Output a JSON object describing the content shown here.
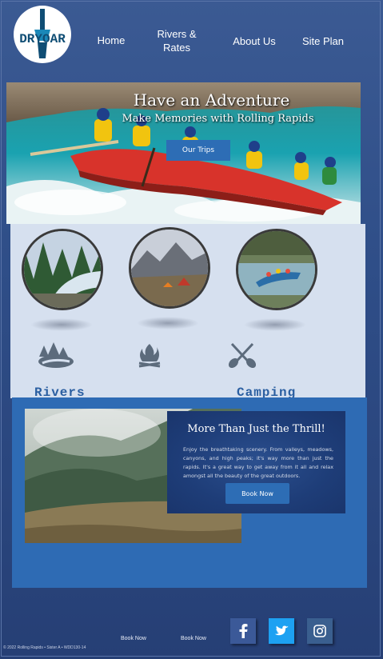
{
  "logo": {
    "text": "DRYOAR"
  },
  "nav": {
    "home": "Home",
    "rivers_rates_1": "Rivers &",
    "rivers_rates_2": "Rates",
    "about": "About Us",
    "site_plan": "Site Plan"
  },
  "hero": {
    "title": "Have an Adventure",
    "subtitle": "Make Memories with Rolling Rapids",
    "cta": "Our Trips"
  },
  "features": {
    "labels": [
      "Rivers",
      "Camping"
    ],
    "icons": [
      "forest-river-icon",
      "campfire-icon",
      "crossed-paddles-icon"
    ]
  },
  "promo": {
    "title": "More Than Just the Thrill!",
    "body": "Enjoy the breathtaking scenery. From valleys, meadows, canyons, and high peaks; it's way more than just the rapids. It's a great way to get away from it all and relax amongst all the beauty of the great outdoors.",
    "button": "Book Now"
  },
  "footer": {
    "copyright": "© 2022 Rolling Rapids • Sister A • WDD130-14",
    "links": [
      "Book Now",
      "Book Now"
    ],
    "social": [
      "facebook-icon",
      "twitter-icon",
      "instagram-icon"
    ]
  },
  "colors": {
    "accent": "#2e6bb4",
    "button": "#2d6db5",
    "feature_bg": "#d6e0ef",
    "label": "#2b5fa1",
    "card": "#1e3d78"
  }
}
